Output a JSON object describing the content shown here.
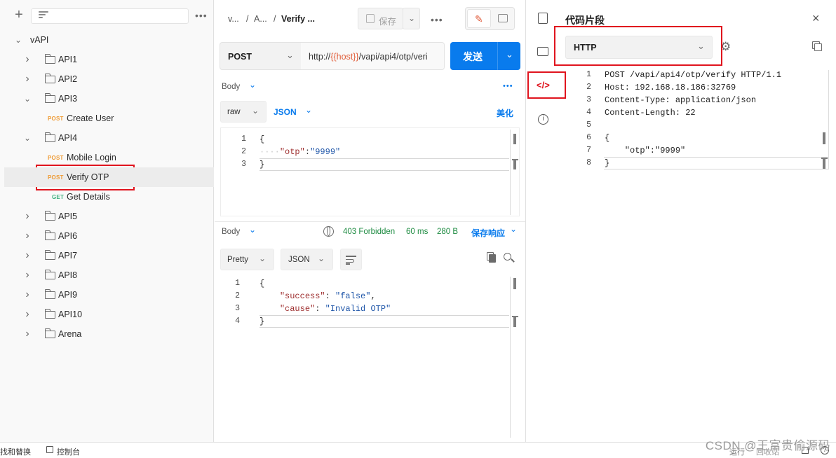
{
  "sidebar": {
    "collection": "vAPI",
    "items": [
      {
        "type": "folder",
        "label": "API1",
        "open": false
      },
      {
        "type": "folder",
        "label": "API2",
        "open": false
      },
      {
        "type": "folder",
        "label": "API3",
        "open": true
      },
      {
        "type": "request",
        "method": "POST",
        "label": "Create User"
      },
      {
        "type": "folder",
        "label": "API4",
        "open": true
      },
      {
        "type": "request",
        "method": "POST",
        "label": "Mobile Login"
      },
      {
        "type": "request",
        "method": "POST",
        "label": "Verify OTP",
        "selected": true
      },
      {
        "type": "request",
        "method": "GET",
        "label": "Get Details"
      },
      {
        "type": "folder",
        "label": "API5",
        "open": false
      },
      {
        "type": "folder",
        "label": "API6",
        "open": false
      },
      {
        "type": "folder",
        "label": "API7",
        "open": false
      },
      {
        "type": "folder",
        "label": "API8",
        "open": false
      },
      {
        "type": "folder",
        "label": "API9",
        "open": false
      },
      {
        "type": "folder",
        "label": "API10",
        "open": false
      },
      {
        "type": "folder",
        "label": "Arena",
        "open": false
      }
    ]
  },
  "tabbar": {
    "breadcrumb_1": "v...",
    "sep_1": "/",
    "breadcrumb_2": "A...",
    "sep_2": "/",
    "breadcrumb_3": "Verify ...",
    "save_label": "保存"
  },
  "request": {
    "method": "POST",
    "url_prefix": "http://",
    "url_var": "{{host}}",
    "url_suffix": "/vapi/api4/otp/veri",
    "send_label": "发送",
    "body_label": "Body",
    "body_mode": "raw",
    "body_lang": "JSON",
    "beautify_label": "美化",
    "body_lines": [
      {
        "n": "1",
        "text": "{"
      },
      {
        "n": "2",
        "key": "\"otp\"",
        "colon": ":",
        "value": "\"9999\""
      },
      {
        "n": "3",
        "text": "}"
      }
    ]
  },
  "response": {
    "body_label": "Body",
    "status": "403 Forbidden",
    "time": "60 ms",
    "size": "280 B",
    "save_label": "保存响应",
    "format": "Pretty",
    "lang": "JSON",
    "lines": [
      {
        "n": "1",
        "text": "{"
      },
      {
        "n": "2",
        "key": "\"success\"",
        "sep": ": ",
        "value": "\"false\"",
        "tail": ","
      },
      {
        "n": "3",
        "key": "\"cause\"",
        "sep": ": ",
        "value": "\"Invalid OTP\"",
        "tail": ""
      },
      {
        "n": "4",
        "text": "}"
      }
    ]
  },
  "snippet": {
    "title": "代码片段",
    "language": "HTTP",
    "lines": [
      {
        "n": "1",
        "text": "POST /vapi/api4/otp/verify HTTP/1.1"
      },
      {
        "n": "2",
        "text": "Host: 192.168.18.186:32769"
      },
      {
        "n": "3",
        "text": "Content-Type: application/json"
      },
      {
        "n": "4",
        "text": "Content-Length: 22"
      },
      {
        "n": "5",
        "text": ""
      },
      {
        "n": "6",
        "text": "{"
      },
      {
        "n": "7",
        "text": "    \"otp\":\"9999\""
      },
      {
        "n": "8",
        "text": "}"
      }
    ]
  },
  "bottombar": {
    "find_replace": "找和替换",
    "console": "控制台",
    "runner": "运行",
    "trash": "回收站"
  },
  "watermark": "CSDN @王富贵偷源码",
  "colors": {
    "accent": "#097bed",
    "post": "#ef9b35",
    "get": "#3eb07f",
    "highlight_box": "#e0141e",
    "status_ok": "#1d8b41"
  }
}
